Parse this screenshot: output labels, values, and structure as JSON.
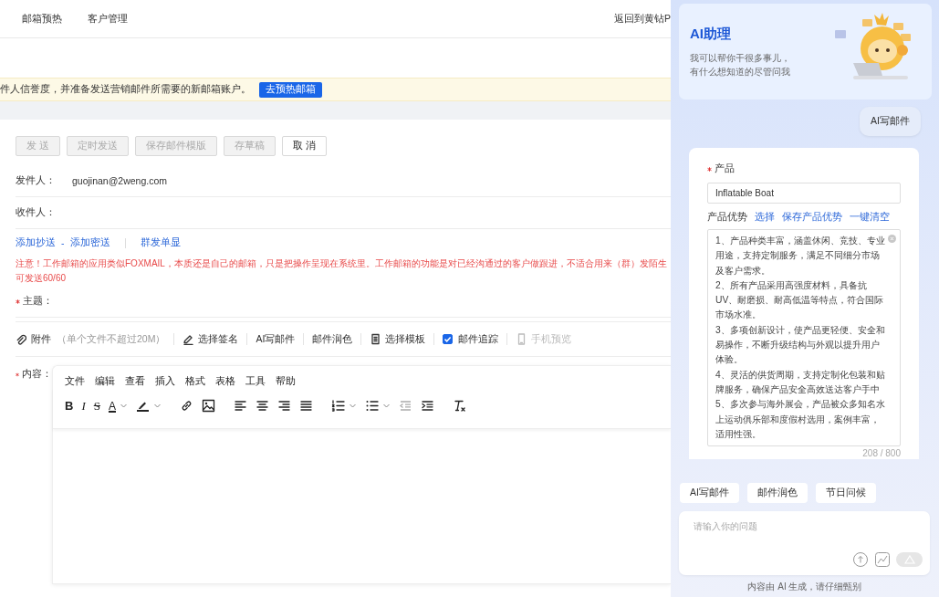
{
  "nav": {
    "items": [
      {
        "label": "邮箱预热"
      },
      {
        "label": "客户管理"
      }
    ],
    "back_link": "返回到黄钻P"
  },
  "banner": {
    "text": "件人信誉度，并准备发送营销邮件所需要的新邮箱账户。",
    "button": "去预热邮箱"
  },
  "actions": [
    {
      "label": "发 送",
      "disabled": true
    },
    {
      "label": "定时发送",
      "disabled": true
    },
    {
      "label": "保存邮件模版",
      "disabled": true
    },
    {
      "label": "存草稿",
      "disabled": true
    },
    {
      "label": "取 消",
      "disabled": false
    }
  ],
  "sender": {
    "label": "发件人：",
    "value": "guojinan@2weng.com"
  },
  "recipient": {
    "label": "收件人："
  },
  "links": {
    "cc": "添加抄送",
    "separator": "-",
    "bcc": "添加密送",
    "bulk": "群发单显"
  },
  "warning": [
    "注意！工作邮箱的应用类似FOXMAIL，本质还是自己的邮箱，只是把操作呈现在系统里。工作邮箱的功能是对已经沟通过的客户做跟进，不适合用来（群）发陌生",
    "可发送60/60"
  ],
  "subject": {
    "label": "主题：",
    "required": true
  },
  "tools": [
    {
      "kind": "attach",
      "label": "附件",
      "hint": "（单个文件不超过20M）",
      "disabled": false
    },
    {
      "kind": "signature",
      "label": "选择签名",
      "disabled": false
    },
    {
      "kind": "plain",
      "label": "AI写邮件",
      "disabled": false
    },
    {
      "kind": "plain",
      "label": "邮件润色",
      "disabled": false
    },
    {
      "kind": "template",
      "label": "选择模板",
      "disabled": false
    },
    {
      "kind": "check",
      "label": "邮件追踪",
      "checked": true,
      "disabled": false
    },
    {
      "kind": "preview",
      "label": "手机预览",
      "disabled": true
    }
  ],
  "content": {
    "label": "内容：",
    "required": true,
    "menu": [
      "文件",
      "编辑",
      "查看",
      "插入",
      "格式",
      "表格",
      "工具",
      "帮助"
    ],
    "toolbar": [
      [
        {
          "kind": "bold",
          "text": "B",
          "caret": false
        },
        {
          "kind": "italic",
          "text": "I",
          "caret": false
        },
        {
          "kind": "strike",
          "text": "S",
          "caret": false
        },
        {
          "kind": "text-color",
          "text": "A",
          "caret": true
        },
        {
          "kind": "highlight",
          "caret": true
        }
      ],
      [
        {
          "kind": "link",
          "caret": false
        },
        {
          "kind": "image",
          "caret": false
        }
      ],
      [
        {
          "kind": "align-left",
          "caret": false
        },
        {
          "kind": "align-center",
          "caret": false
        },
        {
          "kind": "align-right",
          "caret": false
        },
        {
          "kind": "justify",
          "caret": false
        }
      ],
      [
        {
          "kind": "ordered-list",
          "caret": true
        },
        {
          "kind": "bullet-list",
          "caret": true
        },
        {
          "kind": "outdent",
          "caret": false
        },
        {
          "kind": "indent",
          "caret": false
        }
      ],
      [
        {
          "kind": "clear-format",
          "caret": false
        }
      ]
    ]
  },
  "assistant": {
    "title": "AI助理",
    "description": [
      "我可以帮你干很多事儿，",
      "有什么想知道的尽管问我"
    ],
    "user_message": "AI写邮件",
    "form": {
      "product_label": "产品",
      "product_required": true,
      "product_value": "Inflatable Boat",
      "advantages_label": "产品优势",
      "advantage_links": [
        "选择",
        "保存产品优势",
        "一键清空"
      ],
      "advantages": [
        "1、产品种类丰富，涵盖休闲、竞技、专业用途，支持定制服务，满足不同细分市场及客户需求。",
        "2、所有产品采用高强度材料，具备抗 UV、耐磨损、耐高低温等特点，符合国际市场水准。",
        "3、多项创新设计，使产品更轻便、安全和易操作，不断升级结构与外观以提升用户体验。",
        "4、灵活的供货周期，支持定制化包装和贴牌服务，确保产品安全高效送达客户手中",
        "5、多次参与海外展会，产品被众多知名水上运动俱乐部和度假村选用，案例丰富，适用性强。"
      ],
      "counter": "208 / 800"
    },
    "chips": [
      "AI写邮件",
      "邮件润色",
      "节日问候"
    ],
    "input_placeholder": "请输入你的问题",
    "footer": "内容由 AI 生成，请仔细甄别"
  }
}
